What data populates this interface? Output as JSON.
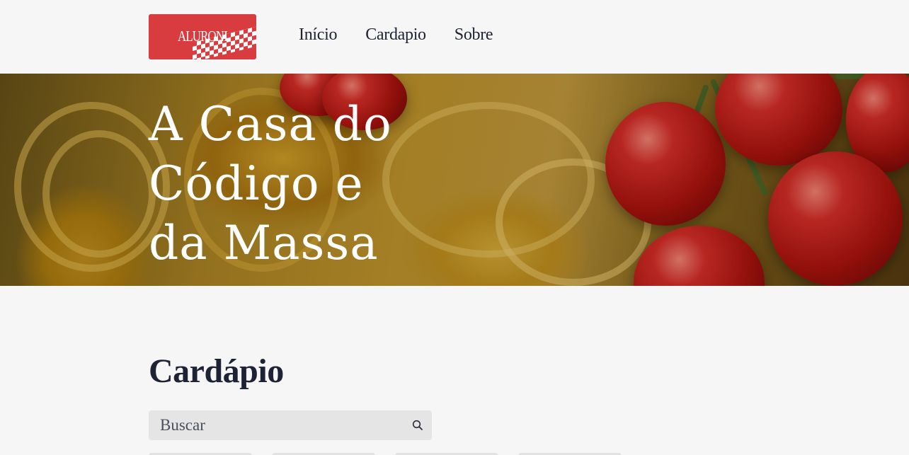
{
  "header": {
    "logo_text": "ALURONI",
    "nav": [
      {
        "label": "Início"
      },
      {
        "label": "Cardapio"
      },
      {
        "label": "Sobre"
      }
    ]
  },
  "hero": {
    "title": "A Casa do Código e da Massa"
  },
  "menu": {
    "title": "Cardápio",
    "search": {
      "placeholder": "Buscar",
      "icon": "search-icon"
    },
    "filters_visible": 4
  },
  "colors": {
    "logo_background": "#d93c3f",
    "text_dark": "#1e2235",
    "page_background": "#f6f6f6",
    "search_background": "#e5e5e5"
  }
}
